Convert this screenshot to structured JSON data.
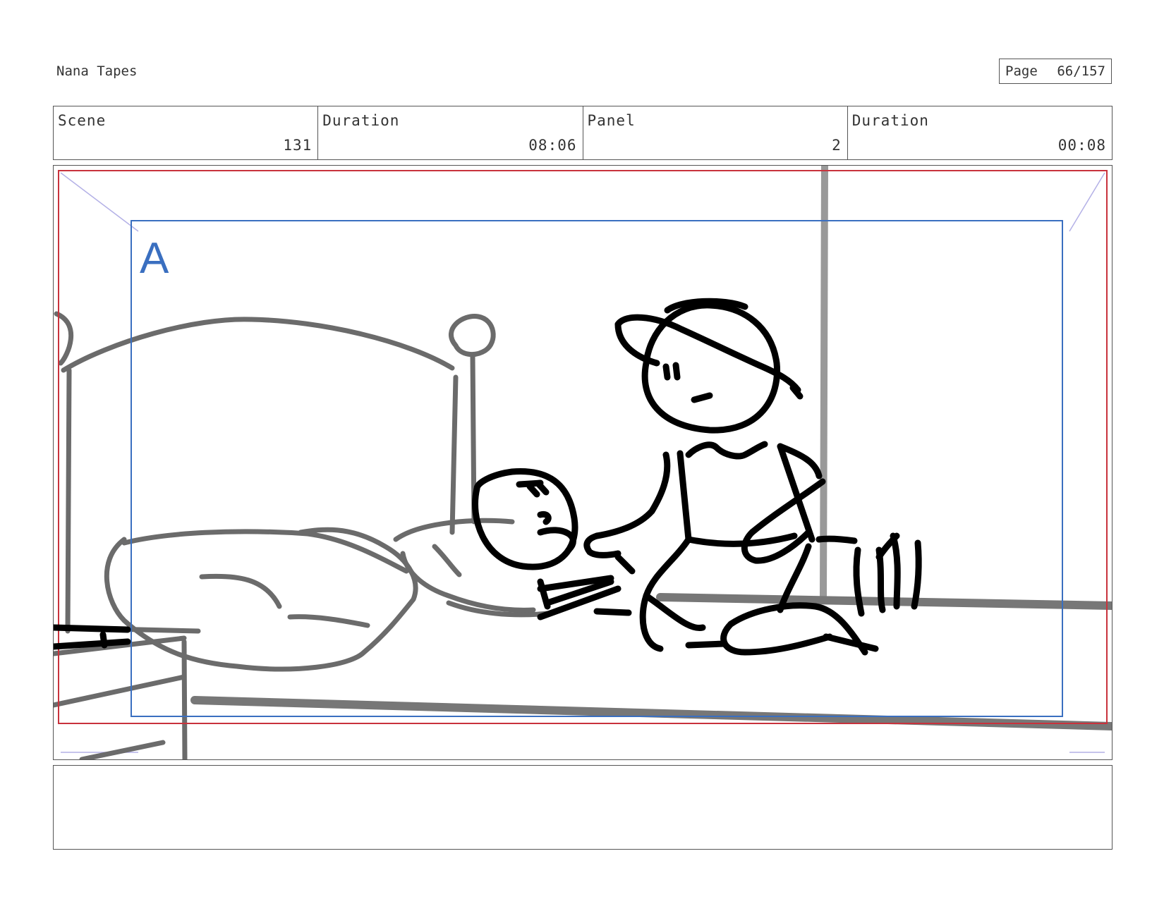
{
  "header": {
    "project_title": "Nana Tapes",
    "page_label": "Page",
    "page_number": "66/157"
  },
  "info_row": {
    "scene_label": "Scene",
    "scene_value": "131",
    "scene_duration_label": "Duration",
    "scene_duration_value": "08:06",
    "panel_label": "Panel",
    "panel_value": "2",
    "panel_duration_label": "Duration",
    "panel_duration_value": "00:08"
  },
  "panel": {
    "camera_key_label": "A",
    "colors": {
      "frame_red": "#c8323c",
      "camera_blue": "#3a6fc0",
      "perspective_lilac": "#b3b0e6",
      "sketch_gray": "#6b6b6b",
      "ink_black": "#000000"
    }
  },
  "caption": {
    "text": ""
  }
}
